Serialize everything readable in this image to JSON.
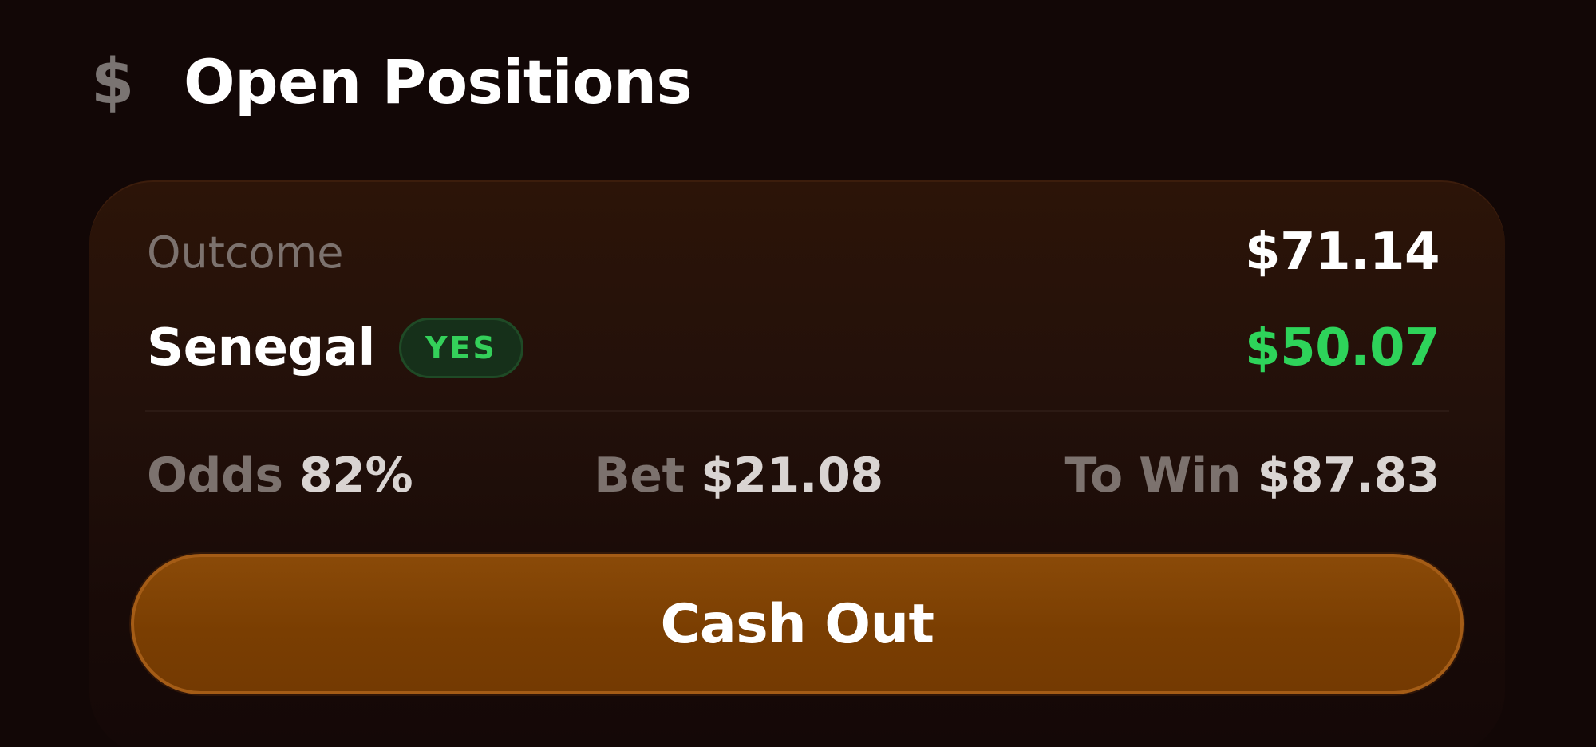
{
  "header": {
    "icon_glyph": "$",
    "icon_name": "dollar-icon",
    "title": "Open Positions"
  },
  "position": {
    "outcome_label": "Outcome",
    "total_value": "$71.14",
    "team": "Senegal",
    "side_badge": "YES",
    "profit": "$50.07",
    "odds_label": "Odds",
    "odds_value": "82%",
    "bet_label": "Bet",
    "bet_value": "$21.08",
    "to_win_label": "To Win",
    "to_win_value": "$87.83",
    "cash_out_label": "Cash Out"
  },
  "colors": {
    "background": "#120706",
    "card": "#22100a",
    "accent_orange": "#7a3e02",
    "positive_green": "#2ed35a",
    "muted_text": "#7c726e"
  }
}
